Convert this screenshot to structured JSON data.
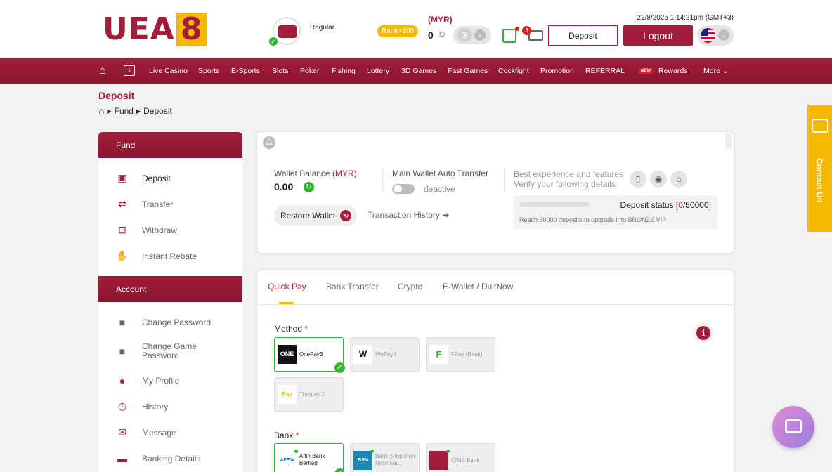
{
  "header": {
    "logo_text": "UEA",
    "logo_num": "8",
    "rank_name": "Regular",
    "rank_badge": "Rank>100",
    "currency": "(MYR)",
    "balance": "0",
    "notif_count": "3",
    "datetime": "22/8/2025 1:14:21pm (GMT+3)",
    "deposit_btn": "Deposit",
    "logout_btn": "Logout"
  },
  "nav": {
    "items": [
      "Live Casino",
      "Sports",
      "E-Sports",
      "Slots",
      "Poker",
      "Fishing",
      "Lottery",
      "3D Games",
      "Fast Games",
      "Cockfight",
      "Promotion",
      "REFERRAL",
      "Rewards",
      "More"
    ],
    "new_badge": "NEW"
  },
  "page": {
    "title": "Deposit",
    "breadcrumb": [
      "Fund",
      "Deposit"
    ]
  },
  "sidebar": {
    "fund_header": "Fund",
    "fund_items": [
      "Deposit",
      "Transfer",
      "Withdraw",
      "Instant Rebate"
    ],
    "account_header": "Account",
    "account_items": [
      "Change Password",
      "Change Game Password",
      "My Profile",
      "History",
      "Message",
      "Banking Details"
    ]
  },
  "wallet": {
    "balance_label": "Wallet Balance ",
    "balance_currency": "(MYR)",
    "balance_value": "0.00",
    "auto_transfer_label": "Main Wallet Auto Transfer",
    "auto_transfer_state": "deactive",
    "best_exp_line1": "Best experience and features",
    "best_exp_line2": "Verify your following details",
    "restore_label": "Restore Wallet",
    "tx_history_label": "Transaction History",
    "deposit_status_label": "Deposit status [",
    "deposit_status_count": "0",
    "deposit_status_total": "/50000]",
    "deposit_status_progress": 0,
    "deposit_status_sub": "Reach 50000 deposits to upgrade into BRONZE VIP"
  },
  "deposit": {
    "tabs": [
      "Quick Pay",
      "Bank Transfer",
      "Crypto",
      "E-Wallet / DuitNow"
    ],
    "active_tab": "Quick Pay",
    "method_label": "Method",
    "bank_label": "Bank",
    "methods": [
      "OnePay3",
      "WePay3",
      "FPay (Bank)",
      "Truepay 2"
    ],
    "selected_method": "OnePay3",
    "banks": [
      {
        "line1": "Affin Bank",
        "line2": "Berhad"
      },
      {
        "line1": "Bank Simpanan",
        "line2": "Nasional..."
      },
      {
        "line1": "CIMB Bank",
        "line2": ""
      }
    ],
    "selected_bank": "Affin Bank Berhad"
  },
  "contact": {
    "label": "Contact Us"
  },
  "colors": {
    "brand": "#a31d3a",
    "accent": "#f5b800",
    "success": "#2fb52f"
  }
}
